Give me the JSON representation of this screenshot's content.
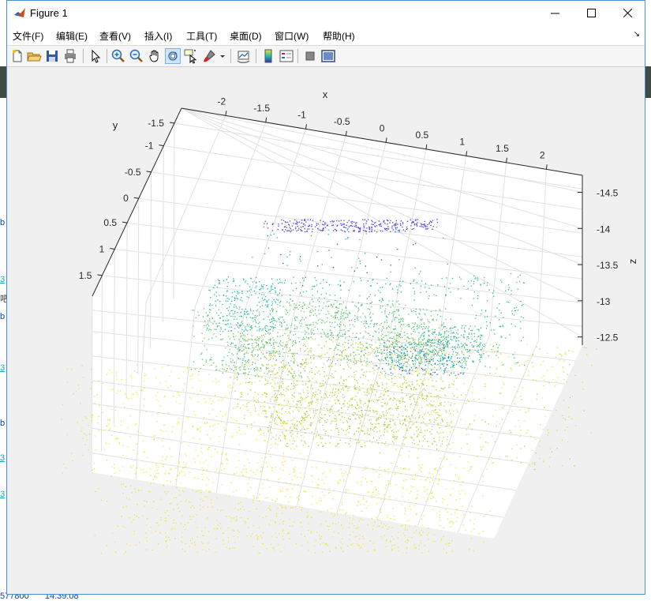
{
  "window": {
    "title": "Figure 1"
  },
  "menu": [
    "文件(F)",
    "编辑(E)",
    "查看(V)",
    "插入(I)",
    "工具(T)",
    "桌面(D)",
    "窗口(W)",
    "帮助(H)"
  ],
  "toolbar_icons": [
    "new-figure-icon",
    "open-file-icon",
    "save-icon",
    "print-icon",
    "select-arrow-icon",
    "zoom-in-icon",
    "zoom-out-icon",
    "pan-hand-icon",
    "rotate-3d-icon",
    "data-cursor-icon",
    "brush-icon",
    "link-plot-icon",
    "colorbar-icon",
    "legend-icon",
    "hide-plot-tools-icon",
    "show-plot-tools-icon"
  ],
  "axes": {
    "x_label": "x",
    "y_label": "y",
    "z_label": "z",
    "x_ticks": [
      "-2",
      "-1.5",
      "-1",
      "-0.5",
      "0",
      "0.5",
      "1",
      "1.5",
      "2"
    ],
    "y_ticks": [
      "-1.5",
      "-1",
      "-0.5",
      "0",
      "0.5",
      "1",
      "1.5"
    ],
    "z_ticks": [
      "-14.5",
      "-14",
      "-13.5",
      "-13",
      "-12.5"
    ]
  },
  "background_fragments": {
    "left": [
      "b",
      "3",
      "吧",
      "b",
      "3",
      "b",
      "3",
      "3"
    ],
    "bottom_id": "577800",
    "bottom_time": "14:39:08"
  }
}
